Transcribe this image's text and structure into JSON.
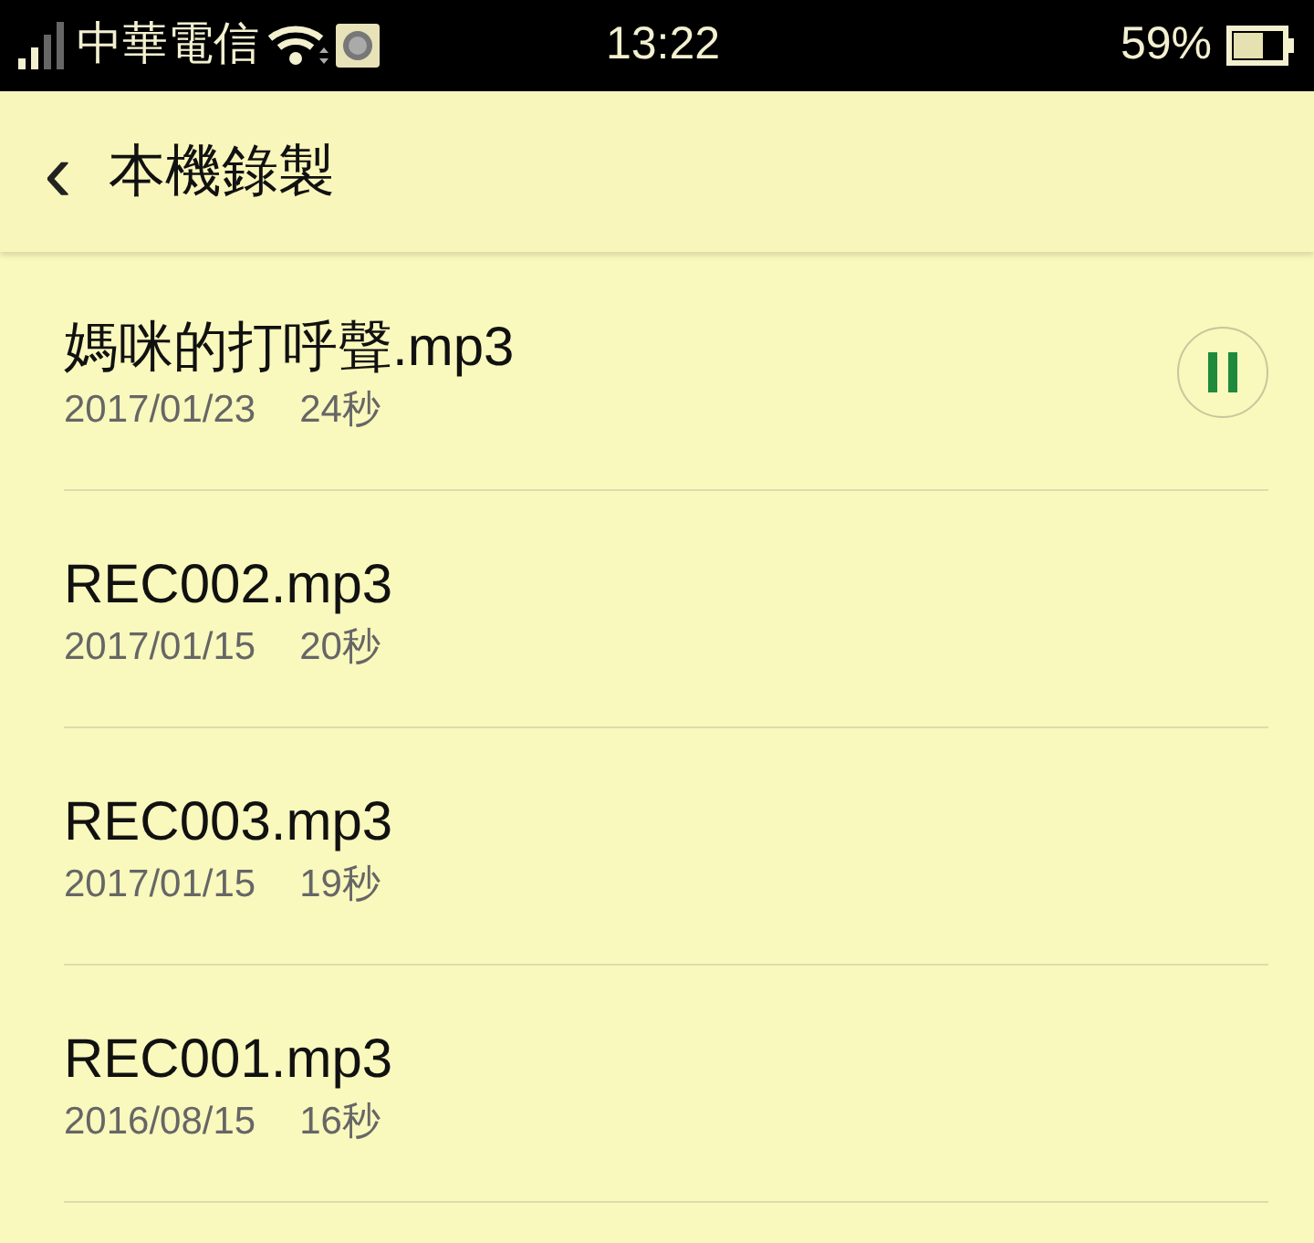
{
  "status_bar": {
    "carrier": "中華電信",
    "time": "13:22",
    "battery": "59%"
  },
  "header": {
    "back": "‹",
    "title": "本機錄製"
  },
  "recordings": [
    {
      "name": "媽咪的打呼聲.mp3",
      "date": "2017/01/23",
      "duration": "24秒",
      "playing": true
    },
    {
      "name": "REC002.mp3",
      "date": "2017/01/15",
      "duration": "20秒",
      "playing": false
    },
    {
      "name": "REC003.mp3",
      "date": "2017/01/15",
      "duration": "19秒",
      "playing": false
    },
    {
      "name": "REC001.mp3",
      "date": "2016/08/15",
      "duration": "16秒",
      "playing": false
    }
  ]
}
